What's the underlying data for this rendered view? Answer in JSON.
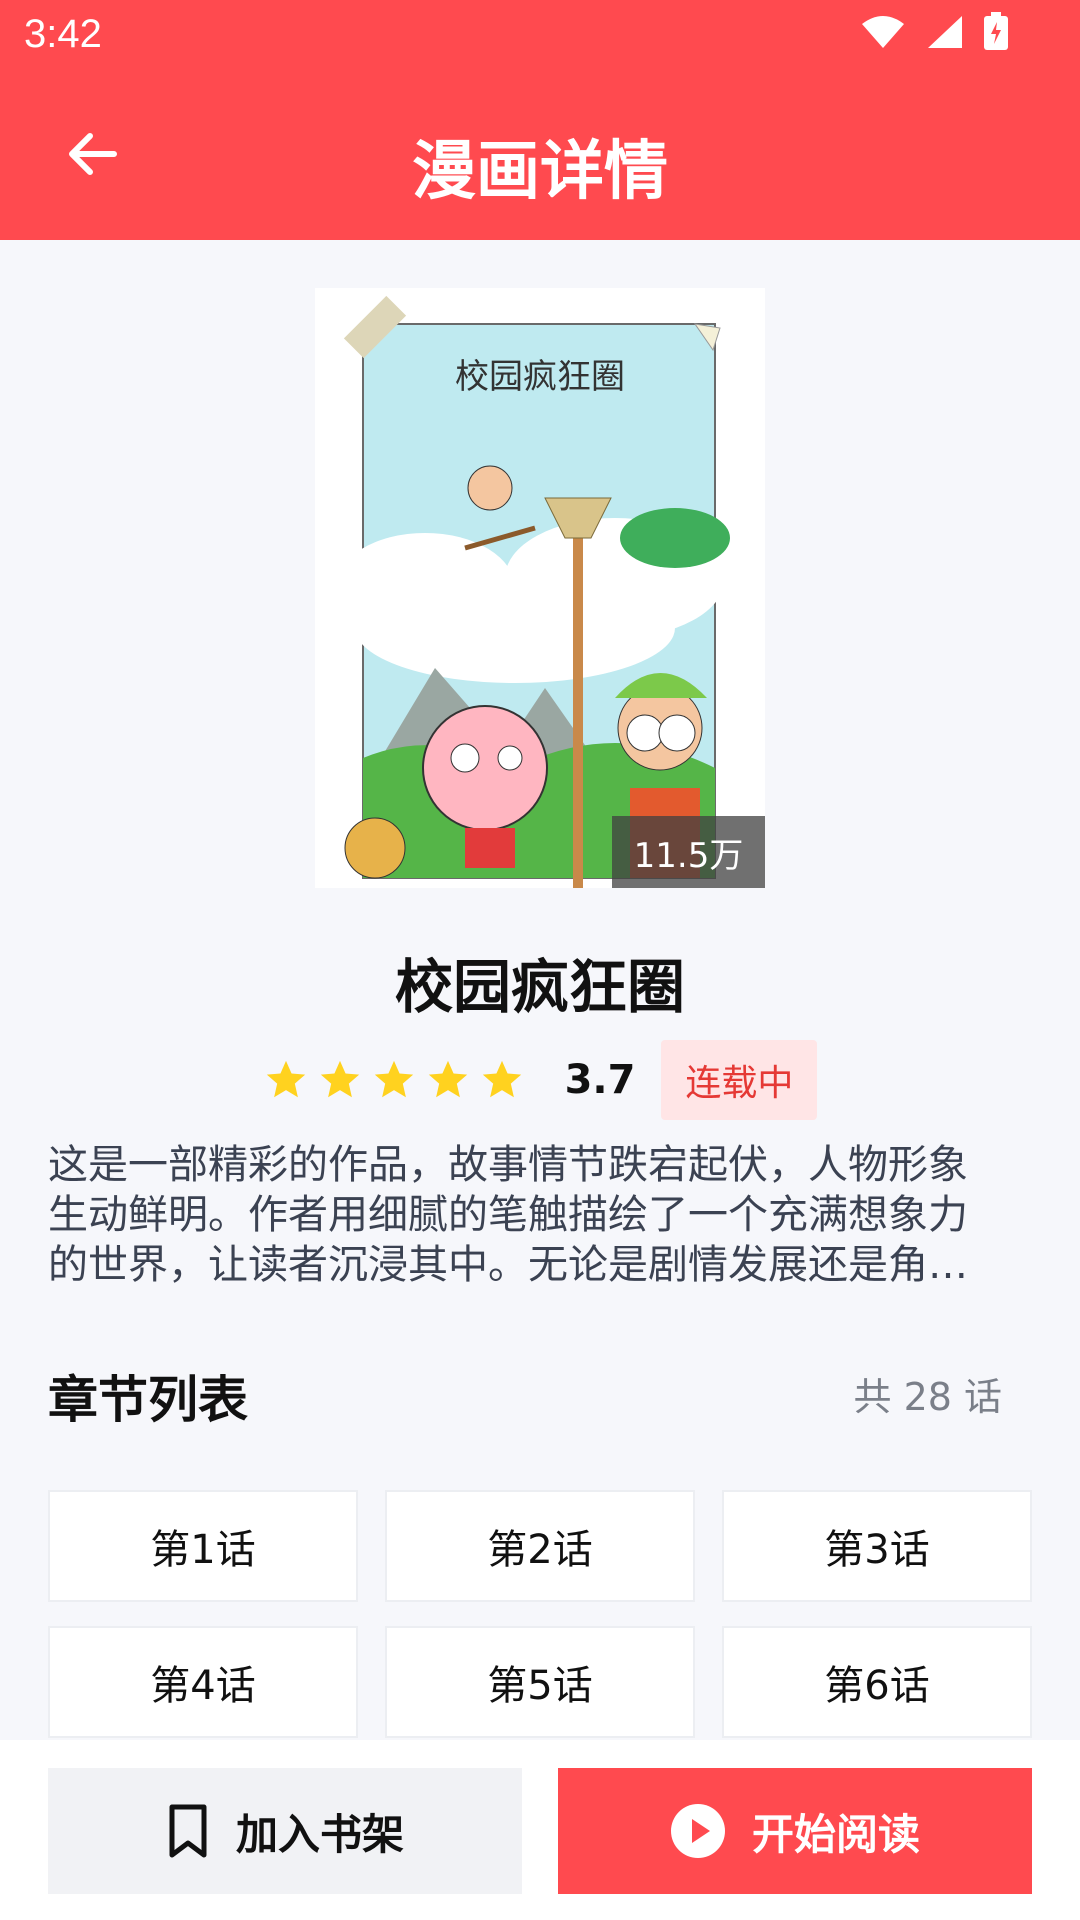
{
  "status_bar": {
    "time": "3:42"
  },
  "app_bar": {
    "title": "漫画详情"
  },
  "comic": {
    "cover_caption": "校园疯狂圈",
    "views": "11.5万",
    "title": "校园疯狂圈",
    "rating": "3.7",
    "stars": 5,
    "status": "连载中",
    "description_lines": [
      "这是一部精彩的作品，故事情节跌宕起伏，人物形象",
      "生动鲜明。作者用细腻的笔触描绘了一个充满想象力",
      "的世界，让读者沉浸其中。无论是剧情发展还是角…"
    ]
  },
  "chapters": {
    "heading": "章节列表",
    "count_label": "共 28 话",
    "items": [
      "第1话",
      "第2话",
      "第3话",
      "第4话",
      "第5话",
      "第6话"
    ]
  },
  "actions": {
    "add_to_shelf": "加入书架",
    "start_reading": "开始阅读"
  },
  "colors": {
    "accent": "#FF4A4F",
    "star": "#FFD21F",
    "badge_bg": "#FFE5E6",
    "badge_text": "#E53935"
  }
}
